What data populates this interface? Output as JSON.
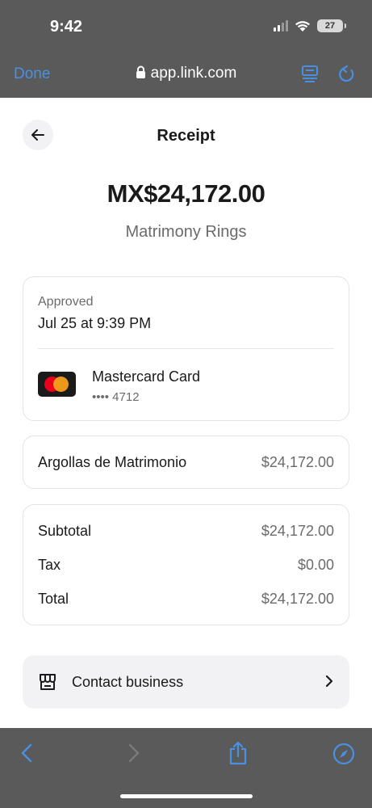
{
  "status_bar": {
    "time": "9:42",
    "battery": "27"
  },
  "browser": {
    "done_label": "Done",
    "url": "app.link.com"
  },
  "receipt": {
    "title": "Receipt",
    "amount": "MX$24,172.00",
    "merchant": "Matrimony Rings",
    "status_label": "Approved",
    "date": "Jul 25 at 9:39 PM",
    "card_name": "Mastercard Card",
    "card_number": "•••• 4712",
    "item": {
      "name": "Argollas de Matrimonio",
      "price": "$24,172.00"
    },
    "totals": [
      {
        "label": "Subtotal",
        "value": "$24,172.00"
      },
      {
        "label": "Tax",
        "value": "$0.00"
      },
      {
        "label": "Total",
        "value": "$24,172.00"
      }
    ],
    "contact_label": "Contact business"
  },
  "colors": {
    "accent": "#4a90e2",
    "chrome": "#5a5a5a",
    "text": "#1a1a1a",
    "muted": "#6b6b6b"
  }
}
